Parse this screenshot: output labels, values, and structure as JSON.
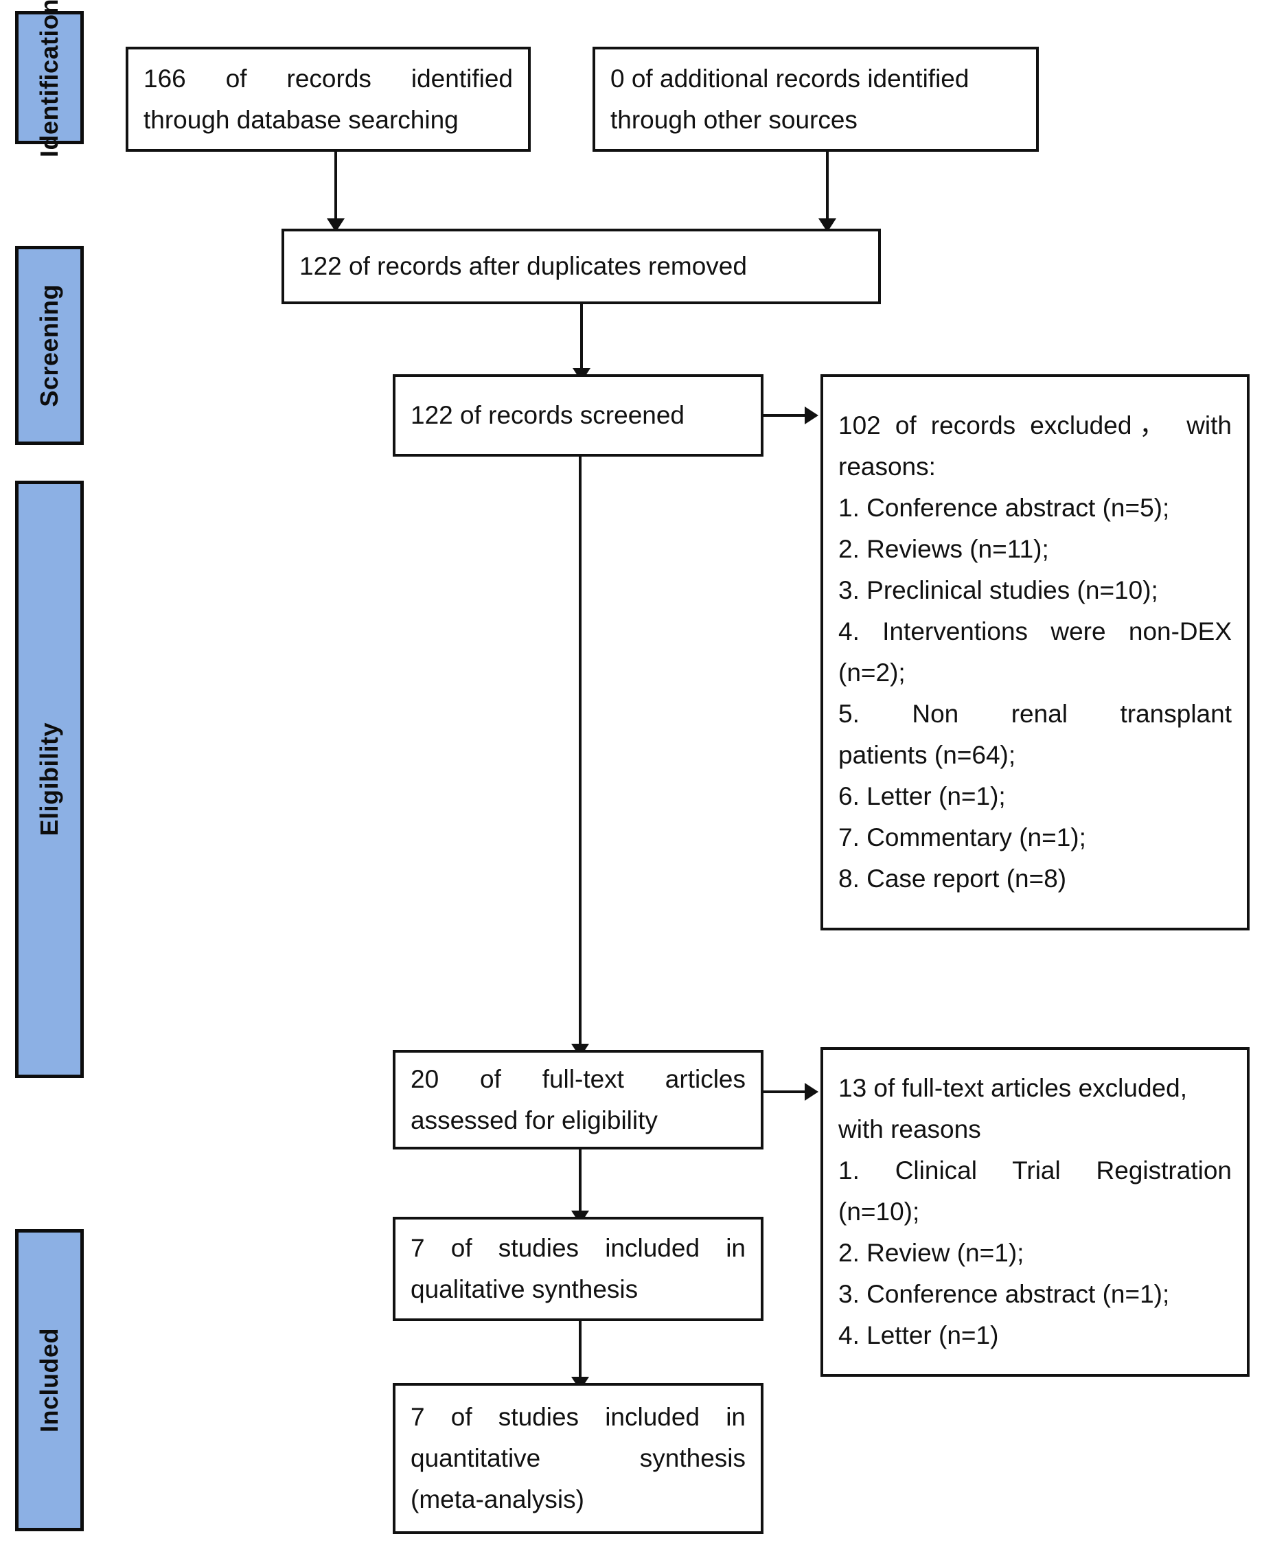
{
  "diagram": {
    "type": "prisma-flow-diagram",
    "accent_color": "#8CB0E4",
    "line_color": "#111111",
    "background": "#ffffff"
  },
  "stages": [
    {
      "id": "identification",
      "label": "Identification"
    },
    {
      "id": "screening",
      "label": "Screening"
    },
    {
      "id": "eligibility",
      "label": "Eligibility"
    },
    {
      "id": "included",
      "label": "Included"
    }
  ],
  "boxes": {
    "records_identified": {
      "line1": "166 of records identified",
      "line2": "through database searching"
    },
    "additional_records": {
      "line1": "0 of additional records identified",
      "line2": "through other sources"
    },
    "duplicates_removed": {
      "line1": "122 of records after duplicates removed"
    },
    "records_screened": {
      "line1": "122 of records screened"
    },
    "records_excluded": {
      "line1": "102 of records excluded，",
      "line1b": "with",
      "line2": "reasons:",
      "reasons": [
        "1.  Conference abstract (n=5);",
        "2.  Reviews (n=11);",
        "3.  Preclinical studies (n=10);",
        "4.  Interventions were non-DEX",
        "(n=2);",
        "5.  Non renal transplant",
        "patients (n=64);",
        "6.  Letter (n=1);",
        "7.  Commentary (n=1);",
        "8.  Case report (n=8)"
      ]
    },
    "fulltext_assessed": {
      "line1": "20 of full-text articles",
      "line2": "assessed for eligibility"
    },
    "fulltext_excluded": {
      "line1": "13 of full-text articles excluded,",
      "line2": "with reasons",
      "reasons": [
        "1.  Clinical Trial Registration",
        "(n=10);",
        "2.  Review (n=1);",
        "3.  Conference abstract (n=1);",
        "4.  Letter (n=1)"
      ]
    },
    "qualitative_synthesis": {
      "line1": "7 of studies included in",
      "line2": "qualitative synthesis"
    },
    "quantitative_synthesis": {
      "line1": "7 of studies included in",
      "line2": "quantitative synthesis",
      "line3": "(meta-analysis)"
    }
  }
}
